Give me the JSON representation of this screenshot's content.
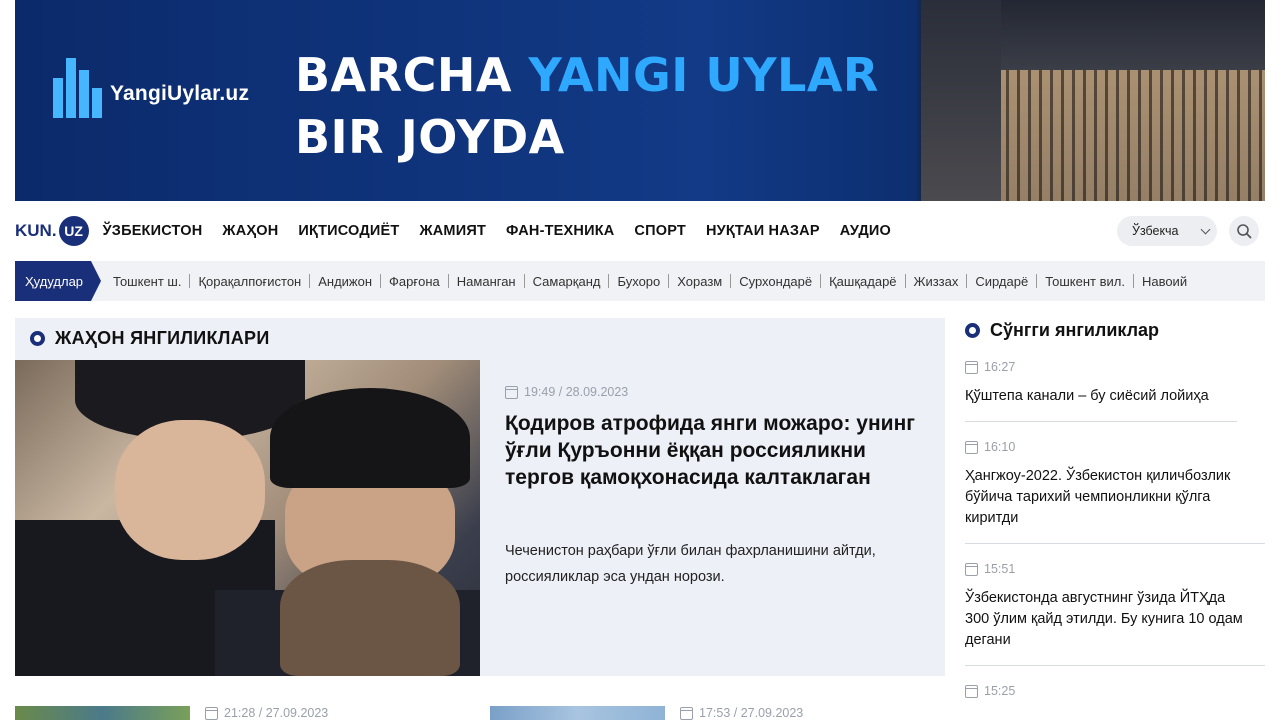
{
  "banner": {
    "logo_text": "YangiUylar.uz",
    "headline_part1": "BARCHA",
    "headline_accent": "YANGI UYLAR",
    "headline_line2": "BIR JOYDA"
  },
  "nav": {
    "logo_kun": "KUN.",
    "logo_uz": "UZ",
    "items": [
      "ЎЗБЕКИСТОН",
      "ЖАҲОН",
      "ИҚТИСОДИЁТ",
      "ЖАМИЯТ",
      "ФАН-ТЕХНИКА",
      "СПОРТ",
      "НУҚТАИ НАЗАР",
      "АУДИО"
    ],
    "language": "Ўзбекча"
  },
  "regions": {
    "label": "Ҳудудлар",
    "items": [
      "Тошкент ш.",
      "Қорақалпоғистон",
      "Андижон",
      "Фарғона",
      "Наманган",
      "Самарқанд",
      "Бухоро",
      "Хоразм",
      "Сурхондарё",
      "Қашқадарё",
      "Жиззах",
      "Сирдарё",
      "Тошкент вил.",
      "Навоий"
    ]
  },
  "main": {
    "section_title": "ЖАҲОН ЯНГИЛИКЛАРИ",
    "featured": {
      "datetime": "19:49 / 28.09.2023",
      "headline": "Қодиров атрофида янги можаро: унинг ўғли Қуръонни ёққан россияликни тергов қамоқхонасида калтаклаган",
      "summary": "Чеченистон раҳбари ўғли билан фахрланишини айтди, россияликлар эса ундан норози."
    },
    "more": [
      {
        "datetime": "21:28 / 27.09.2023"
      },
      {
        "datetime": "17:53 / 27.09.2023"
      }
    ]
  },
  "sidebar": {
    "title": "Сўнгги янгиликлар",
    "items": [
      {
        "time": "16:27",
        "text": "Қўштепа канали – бу сиёсий лойиҳа"
      },
      {
        "time": "16:10",
        "text": "Ҳангжоу-2022. Ўзбекистон қиличбозлик бўйича тарихий чемпионликни қўлга киритди"
      },
      {
        "time": "15:51",
        "text": "Ўзбекистонда августнинг ўзида ЙТҲда 300 ўлим қайд этилди. Бу кунига 10 одам дегани"
      },
      {
        "time": "15:25",
        "text": ""
      }
    ]
  },
  "colors": {
    "brand": "#1a2f7a",
    "banner_bg": "#0b2a6b",
    "banner_accent": "#2fa8ff",
    "panel_bg": "#eef0f8",
    "regions_bg": "#f1f2f6"
  }
}
